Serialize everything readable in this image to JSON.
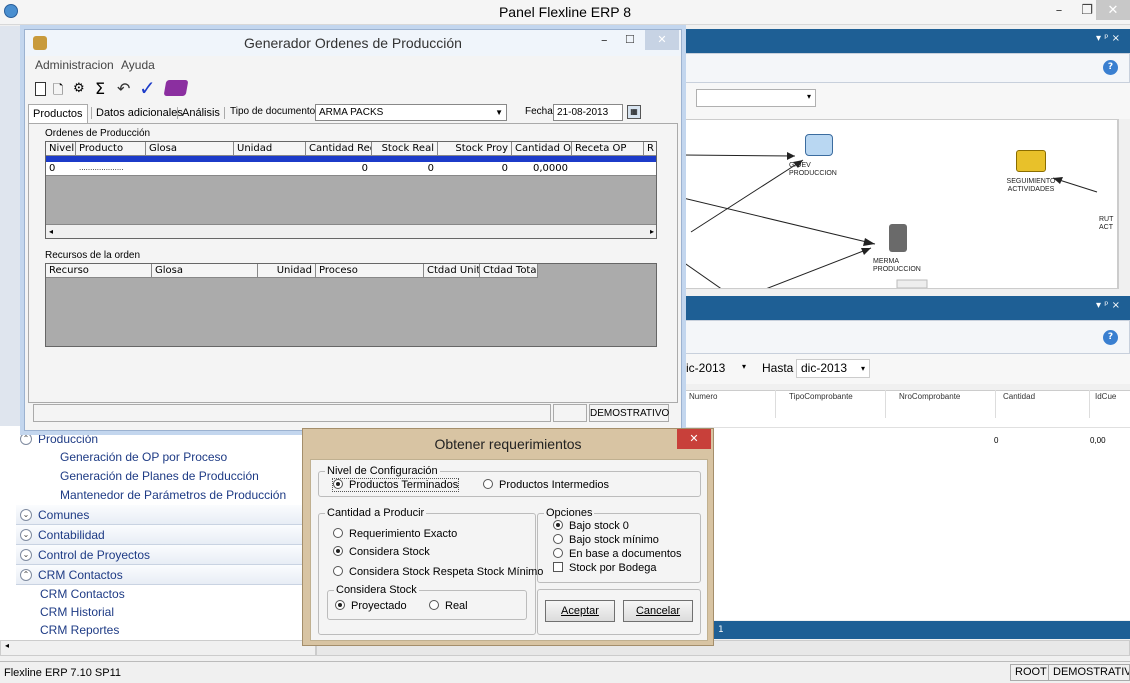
{
  "app": {
    "title": "Panel Flexline ERP 8",
    "minimize": "–",
    "restore": "❐",
    "close": "✕"
  },
  "generador": {
    "title": "Generador Ordenes de Producción",
    "menu": [
      "Administracion",
      "Ayuda"
    ],
    "tabs": [
      "Productos",
      "Datos adicionales",
      "Análisis"
    ],
    "tipo_label": "Tipo de documento",
    "tipo_value": "ARMA PACKS",
    "fecha_label": "Fecha",
    "fecha_value": "21-08-2013",
    "ordenes_label": "Ordenes de Producción",
    "ordenes_cols": [
      "Nivel",
      "Producto",
      "Glosa",
      "Unidad",
      "Cantidad Req.",
      "Stock Real",
      "Stock Proy",
      "Cantidad OP",
      "Receta OP",
      "R"
    ],
    "ordenes_row": [
      "0",
      "....................",
      "",
      "",
      "0",
      "0",
      "0",
      "0,0000",
      "",
      ""
    ],
    "recursos_label": "Recursos de la orden",
    "recursos_cols": [
      "Recurso",
      "Glosa",
      "Unidad",
      "Proceso",
      "Ctdad Unit.",
      "Ctdad Total"
    ],
    "status_right": "DEMOSTRATIVO"
  },
  "obtener": {
    "title": "Obtener requerimientos",
    "nivel_legend": "Nivel de Configuración",
    "nivel_opts": [
      "Productos Terminados",
      "Productos Intermedios"
    ],
    "cantidad_legend": "Cantidad a Producir",
    "cantidad_opts": [
      "Requerimiento Exacto",
      "Considera Stock",
      "Considera Stock Respeta Stock Mínimo"
    ],
    "considera_legend": "Considera Stock",
    "considera_opts": [
      "Proyectado",
      "Real"
    ],
    "opciones_legend": "Opciones",
    "opciones_radios": [
      "Bajo stock 0",
      "Bajo stock mínimo",
      "En base a documentos"
    ],
    "opciones_check": "Stock por Bodega",
    "aceptar": "Aceptar",
    "cancelar": "Cancelar"
  },
  "sidebar": {
    "produccion": "Producción",
    "produccion_items": [
      "Generación de OP por Proceso",
      "Generación de Planes de Producción",
      "Mantenedor de Parámetros de Producción"
    ],
    "comunes": "Comunes",
    "contabilidad": "Contabilidad",
    "proyectos": "Control de Proyectos",
    "crm": "CRM Contactos",
    "crm_items": [
      "CRM Contactos",
      "CRM Historial",
      "CRM Reportes"
    ]
  },
  "diagram": {
    "nodes": [
      "G/DEV PRODUCCION",
      "MERMA PRODUCCION",
      "SEGUIMIENTO ACTIVIDADES",
      "RUT ACT"
    ]
  },
  "filter": {
    "desde": "ic-2013",
    "hasta_label": "Hasta",
    "hasta": "dic-2013"
  },
  "grid2": {
    "cols": [
      "Numero",
      "TipoComprobante",
      "NroComprobante",
      "Cantidad",
      "IdCue"
    ],
    "row": [
      "0",
      "0,00"
    ],
    "bottom_bar": "1"
  },
  "status": {
    "left": "Flexline ERP  7.10  SP11",
    "user": "ROOT",
    "company": "DEMOSTRATIVO"
  },
  "colors": {
    "dock": "#1e5f95",
    "dialog": "#d8c4a3",
    "selection": "#1c3bc9"
  }
}
